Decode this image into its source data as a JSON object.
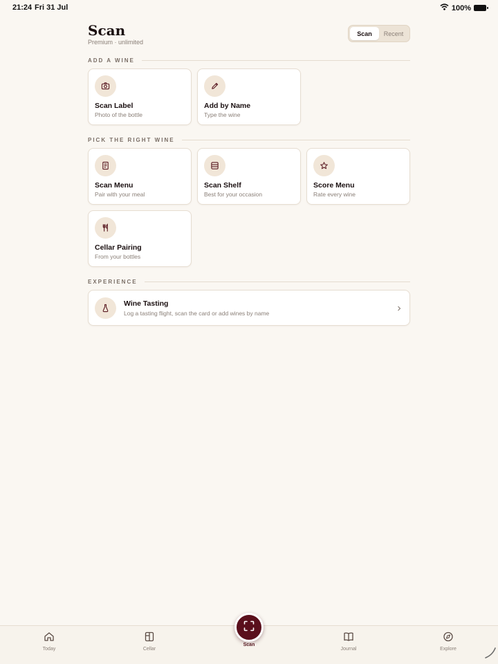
{
  "status": {
    "time": "21:24",
    "date": "Fri 31 Jul",
    "battery": "100%"
  },
  "header": {
    "title": "Scan",
    "subtitle": "Premium · unlimited"
  },
  "segmented": {
    "options": [
      "Scan",
      "Recent"
    ],
    "selected": "Scan"
  },
  "sections": {
    "add": {
      "title": "ADD A WINE",
      "cards": [
        {
          "title": "Scan Label",
          "subtitle": "Photo of the bottle",
          "icon": "camera-icon"
        },
        {
          "title": "Add by Name",
          "subtitle": "Type the wine",
          "icon": "pencil-icon"
        }
      ]
    },
    "pick": {
      "title": "PICK THE RIGHT WINE",
      "cards": [
        {
          "title": "Scan Menu",
          "subtitle": "Pair with your meal",
          "icon": "menu-icon"
        },
        {
          "title": "Scan Shelf",
          "subtitle": "Best for your occasion",
          "icon": "shelf-icon"
        },
        {
          "title": "Score Menu",
          "subtitle": "Rate every wine",
          "icon": "star-icon"
        },
        {
          "title": "Cellar Pairing",
          "subtitle": "From your bottles",
          "icon": "fork-knife-icon"
        }
      ]
    },
    "experience": {
      "title": "EXPERIENCE",
      "item": {
        "title": "Wine Tasting",
        "subtitle": "Log a tasting flight, scan the card or add wines by name",
        "icon": "flask-icon"
      }
    }
  },
  "tabbar": {
    "tabs": [
      {
        "label": "Today",
        "icon": "home-icon"
      },
      {
        "label": "Cellar",
        "icon": "cellar-icon"
      },
      {
        "label": "Scan",
        "icon": "scan-icon"
      },
      {
        "label": "Journal",
        "icon": "journal-icon"
      },
      {
        "label": "Explore",
        "icon": "compass-icon"
      }
    ],
    "active": "Scan"
  },
  "colors": {
    "background": "#faf7f2",
    "accent": "#5a0f1c",
    "icon_bg": "#f1e6d8",
    "icon_stroke": "#5a1a22"
  }
}
